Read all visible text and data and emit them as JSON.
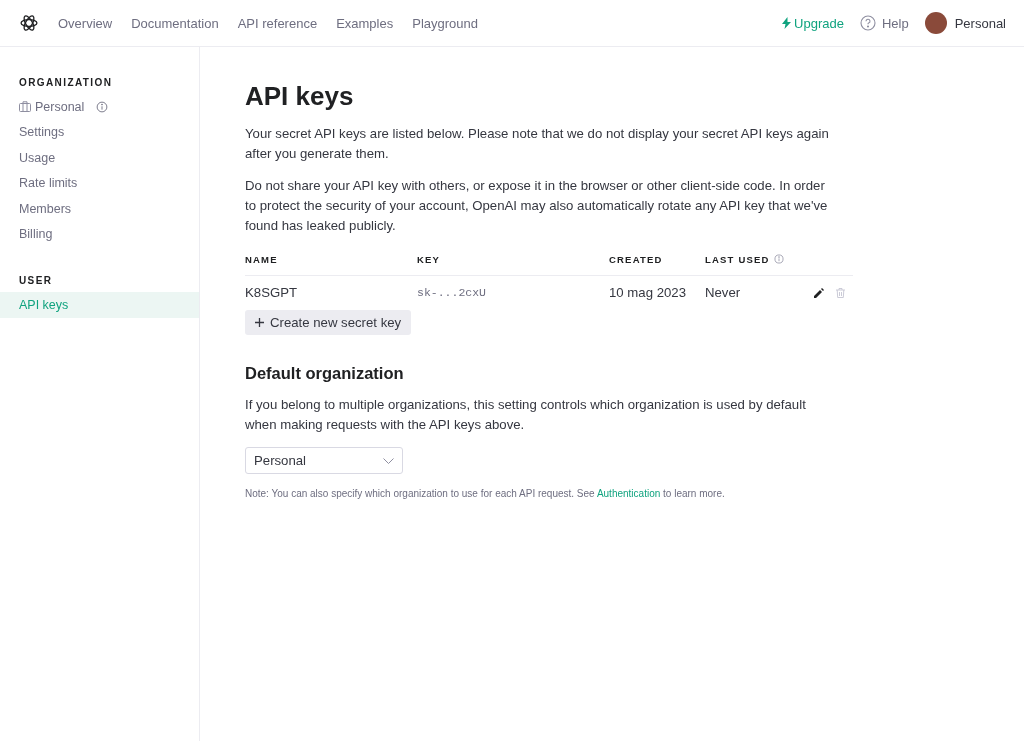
{
  "topbar": {
    "nav": [
      {
        "label": "Overview"
      },
      {
        "label": "Documentation"
      },
      {
        "label": "API reference"
      },
      {
        "label": "Examples"
      },
      {
        "label": "Playground"
      }
    ],
    "upgrade": "Upgrade",
    "help": "Help",
    "account": "Personal"
  },
  "sidebar": {
    "sections": [
      {
        "heading": "ORGANIZATION",
        "items": [
          {
            "label": "Personal",
            "kind": "org",
            "selected": false
          },
          {
            "label": "Settings",
            "kind": "link",
            "selected": false
          },
          {
            "label": "Usage",
            "kind": "link",
            "selected": false
          },
          {
            "label": "Rate limits",
            "kind": "link",
            "selected": false
          },
          {
            "label": "Members",
            "kind": "link",
            "selected": false
          },
          {
            "label": "Billing",
            "kind": "link",
            "selected": false
          }
        ]
      },
      {
        "heading": "USER",
        "items": [
          {
            "label": "API keys",
            "kind": "link",
            "selected": true
          }
        ]
      }
    ]
  },
  "main": {
    "title": "API keys",
    "paragraphs": [
      "Your secret API keys are listed below. Please note that we do not display your secret API keys again after you generate them.",
      "Do not share your API key with others, or expose it in the browser or other client-side code. In order to protect the security of your account, OpenAI may also automatically rotate any API key that we've found has leaked publicly."
    ],
    "table": {
      "columns": [
        {
          "label": "NAME",
          "info": false
        },
        {
          "label": "KEY",
          "info": false
        },
        {
          "label": "CREATED",
          "info": false
        },
        {
          "label": "LAST USED",
          "info": true
        }
      ],
      "rows": [
        {
          "name": "K8SGPT",
          "key": "sk-...2cxU",
          "created": "10 mag 2023",
          "last_used": "Never"
        }
      ]
    },
    "create_button": "Create new secret key",
    "default_org": {
      "heading": "Default organization",
      "description": "If you belong to multiple organizations, this setting controls which organization is used by default when making requests with the API keys above.",
      "select_value": "Personal",
      "note": {
        "before": "Note: You can also specify which organization to use for each API request. See ",
        "link": "Authentication",
        "after": " to learn more."
      }
    }
  }
}
